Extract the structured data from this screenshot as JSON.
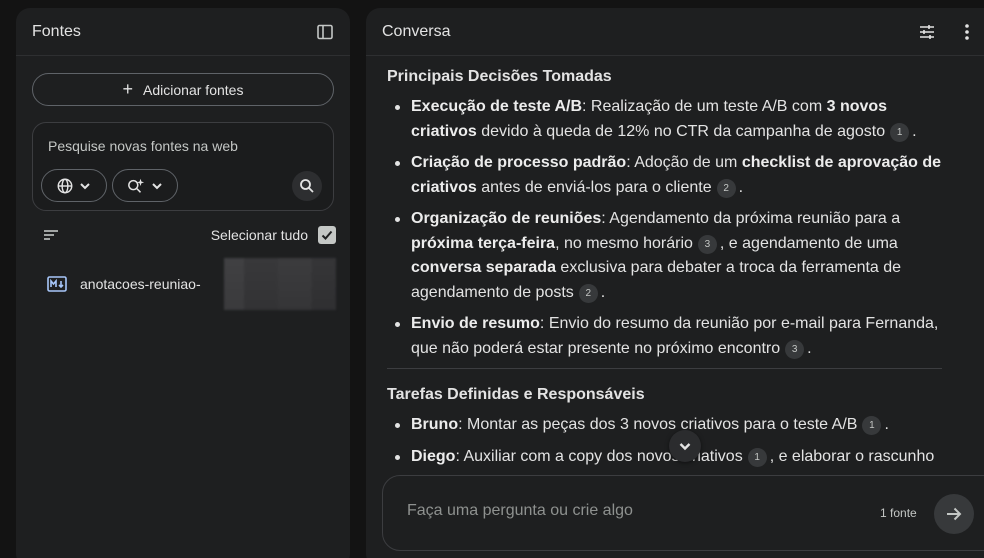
{
  "sources_panel": {
    "title": "Fontes",
    "add_button_label": "Adicionar fontes",
    "search_placeholder": "Pesquise novas fontes na web",
    "select_all_label": "Selecionar tudo",
    "select_all_checked": true,
    "items": [
      {
        "name": "anotacoes-reuniao-",
        "checked": true
      }
    ]
  },
  "chat_panel": {
    "title": "Conversa",
    "section1": {
      "title": "Principais Decisões Tomadas",
      "items": [
        {
          "bold": "Execução de teste A/B",
          "text_a": ": Realização de um teste A/B com ",
          "bold2": "3 novos criativos",
          "text_b": " devido à queda de 12% no CTR da campanha de agosto",
          "cite": "1",
          "end": "."
        },
        {
          "bold": "Criação de processo padrão",
          "text_a": ": Adoção de um ",
          "bold2": "checklist de aprovação de criativos",
          "text_b": " antes de enviá-los para o cliente",
          "cite": "2",
          "end": "."
        },
        {
          "bold": "Organização de reuniões",
          "text_a": ": Agendamento da próxima reunião para a ",
          "bold2": "próxima terça-feira",
          "text_b": ", no mesmo horário",
          "cite": "3",
          "text_c": ", e agendamento de uma ",
          "bold3": "conversa separada",
          "text_d": " exclusiva para debater a troca da ferramenta de agendamento de posts",
          "cite2": "2",
          "end": "."
        },
        {
          "bold": "Envio de resumo",
          "text_a": ": Envio do resumo da reunião por e-mail para Fernanda, que não poderá estar presente no próximo encontro",
          "cite": "3",
          "end": "."
        }
      ]
    },
    "section2": {
      "title": "Tarefas Definidas e Responsáveis",
      "items": [
        {
          "bold": "Bruno",
          "text_a": ": Montar as peças dos 3 novos criativos para o teste A/B",
          "cite": "1",
          "end": "."
        },
        {
          "bold": "Diego",
          "text_a": ": Auxiliar com a copy dos novos criativos",
          "cite": "1",
          "text_b": ", e elaborar o rascunho"
        }
      ]
    },
    "composer": {
      "placeholder": "Faça uma pergunta ou crie algo",
      "source_count": "1 fonte"
    }
  },
  "icons": {
    "panel_toggle": "sidebar-toggle-icon",
    "tune": "tune-icon",
    "more": "more-vert-icon",
    "web": "globe-icon",
    "research": "research-sparkle-icon",
    "search": "search-icon",
    "filter": "sort-icon",
    "file": "markdown-file-icon",
    "send": "arrow-right-icon",
    "scroll": "chevron-down-icon"
  },
  "colors": {
    "background": "#131313",
    "panel": "#1e1f20",
    "text": "#e3e3e3",
    "file_icon": "#a8c7fa"
  }
}
